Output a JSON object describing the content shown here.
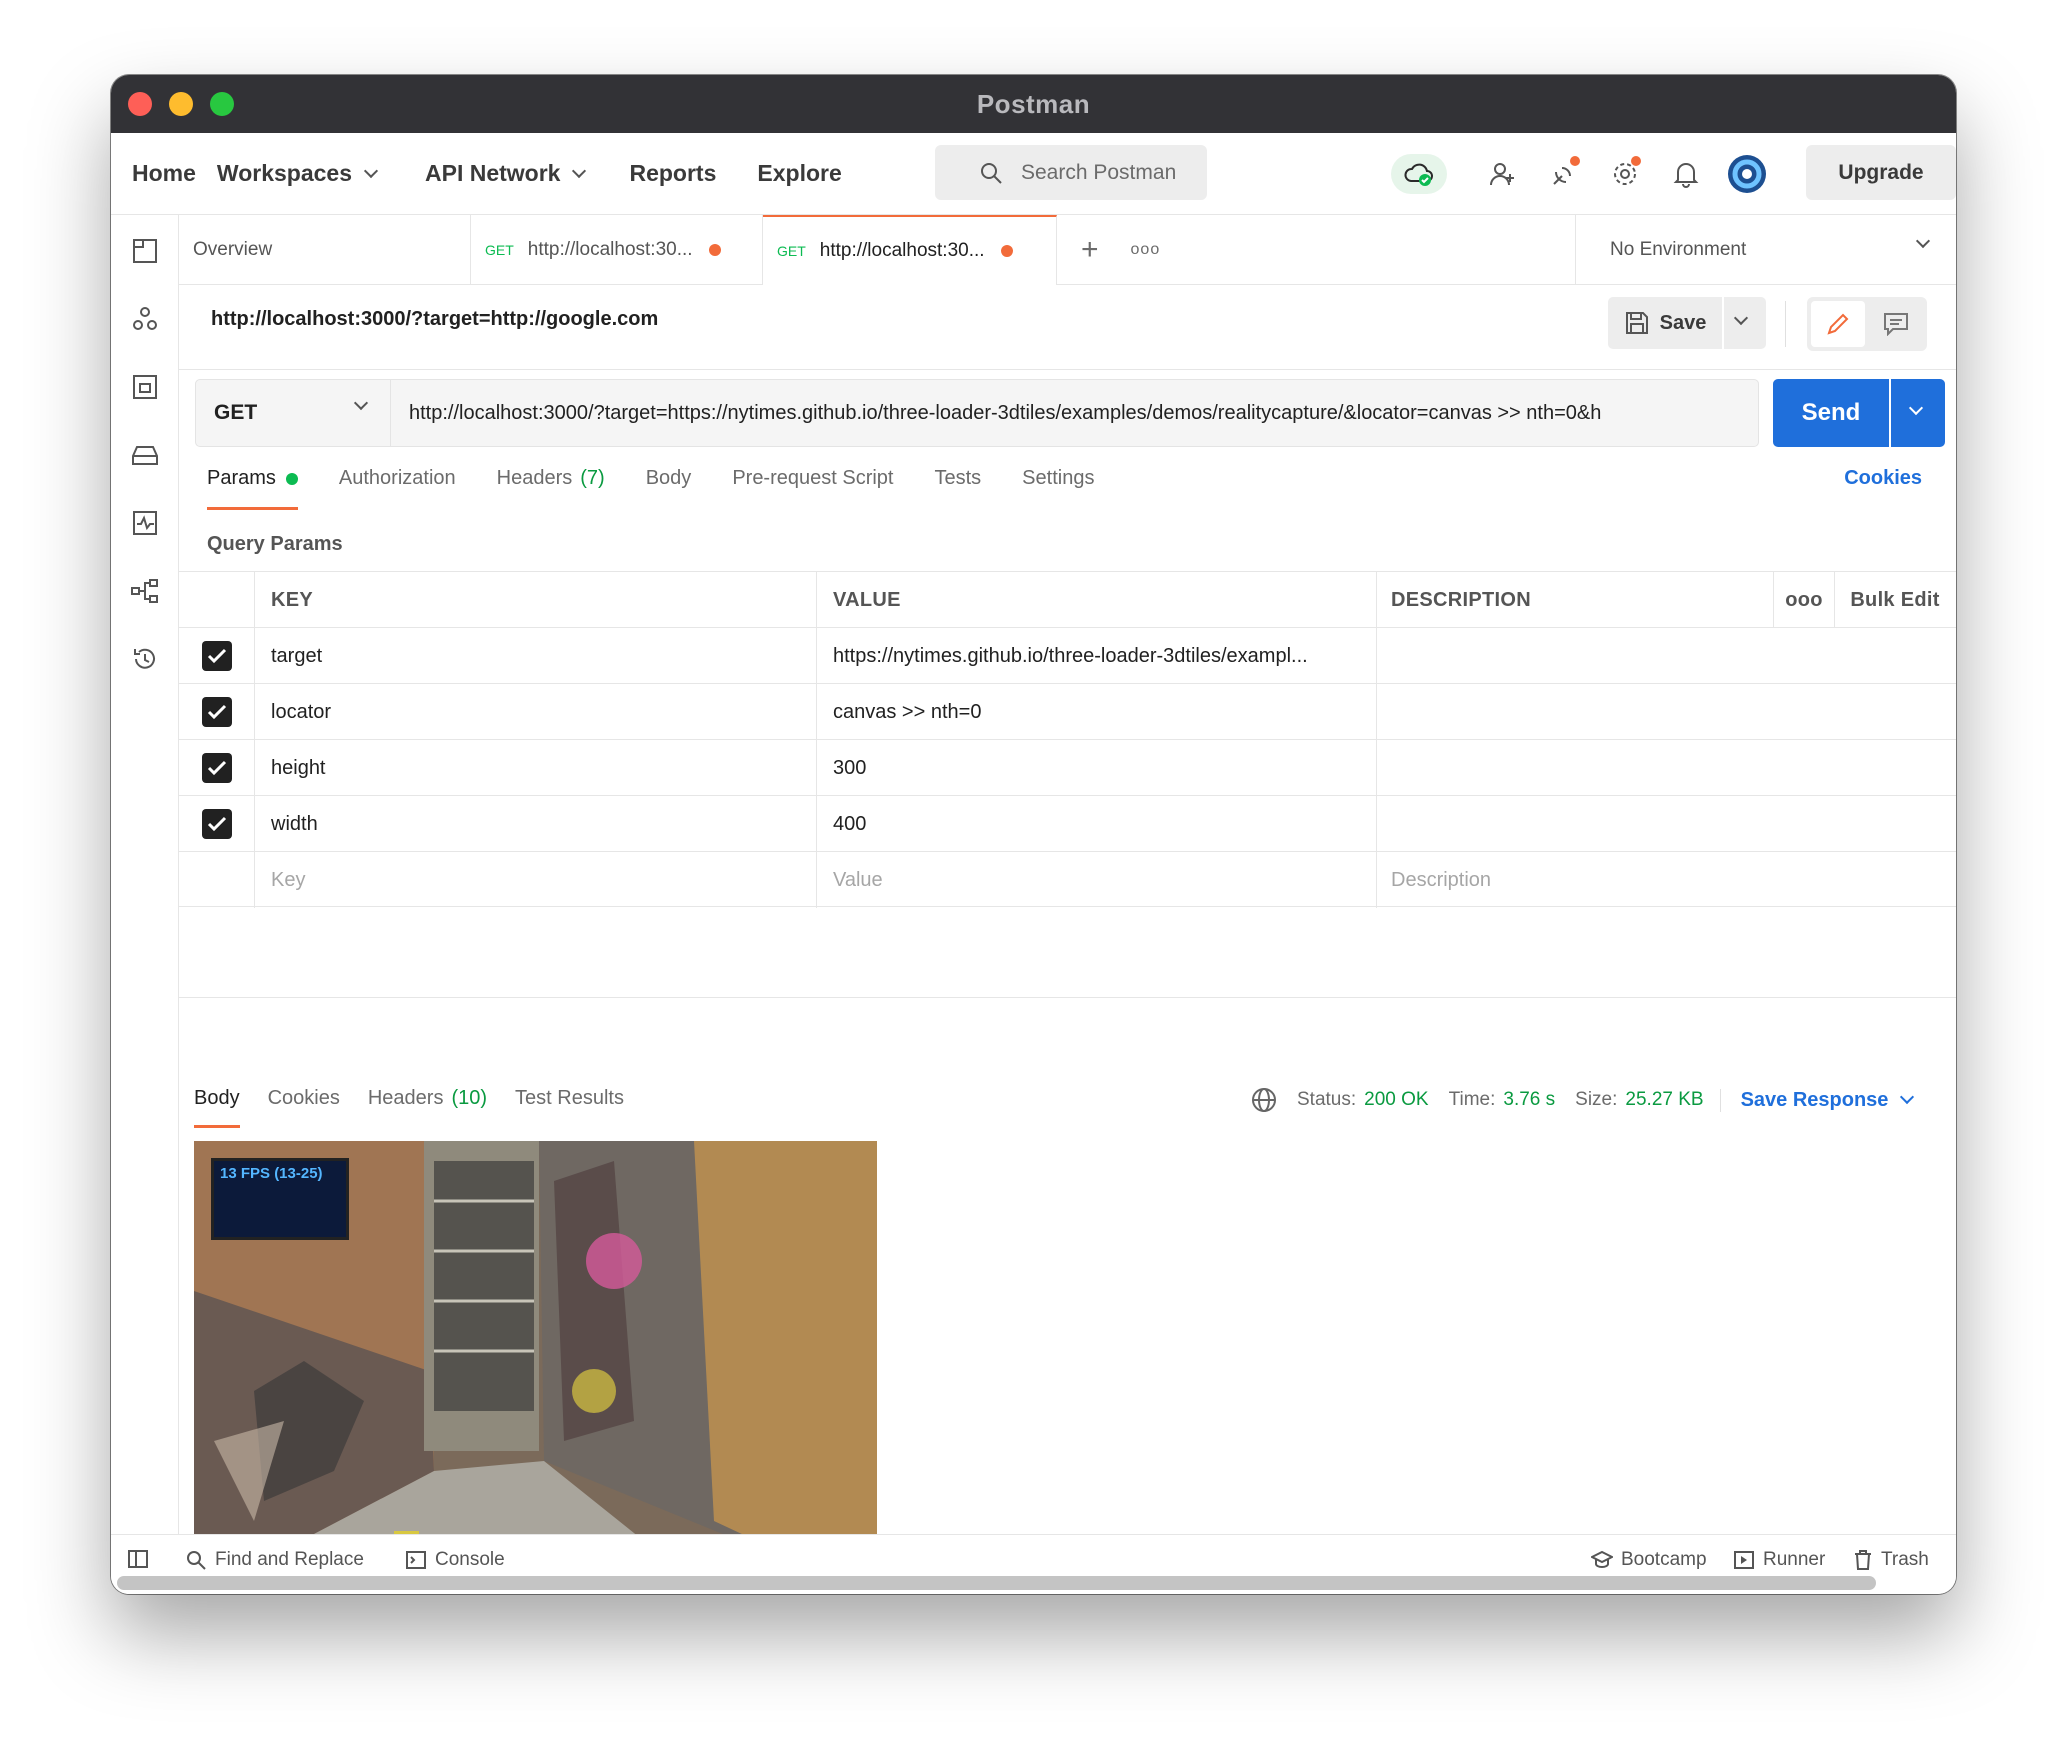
{
  "window": {
    "title": "Postman"
  },
  "nav": {
    "items": [
      "Home",
      "Workspaces",
      "API Network",
      "Reports",
      "Explore"
    ],
    "search_placeholder": "Search Postman",
    "upgrade_label": "Upgrade"
  },
  "tabs": {
    "overview": "Overview",
    "items": [
      {
        "method": "GET",
        "label": "http://localhost:30..."
      },
      {
        "method": "GET",
        "label": "http://localhost:30..."
      }
    ],
    "add": "+",
    "more": "ooo",
    "environment": "No Environment"
  },
  "request": {
    "name": "http://localhost:3000/?target=http://google.com",
    "save_label": "Save",
    "method": "GET",
    "url": "http://localhost:3000/?target=https://nytimes.github.io/three-loader-3dtiles/examples/demos/realitycapture/&locator=canvas >> nth=0&h",
    "send_label": "Send"
  },
  "request_tabs": {
    "params": "Params",
    "authorization": "Authorization",
    "headers": "Headers",
    "headers_count": "(7)",
    "body": "Body",
    "pre_request": "Pre-request Script",
    "tests": "Tests",
    "settings": "Settings",
    "cookies": "Cookies"
  },
  "query_params": {
    "title": "Query Params",
    "headers": {
      "key": "KEY",
      "value": "VALUE",
      "description": "DESCRIPTION",
      "more": "ooo",
      "bulk_edit": "Bulk Edit"
    },
    "rows": [
      {
        "key": "target",
        "value": "https://nytimes.github.io/three-loader-3dtiles/exampl..."
      },
      {
        "key": "locator",
        "value": "canvas >> nth=0"
      },
      {
        "key": "height",
        "value": "300"
      },
      {
        "key": "width",
        "value": "400"
      }
    ],
    "placeholders": {
      "key": "Key",
      "value": "Value",
      "description": "Description"
    }
  },
  "response": {
    "tabs": {
      "body": "Body",
      "cookies": "Cookies",
      "headers": "Headers",
      "headers_count": "(10)",
      "test_results": "Test Results"
    },
    "status_label": "Status:",
    "status_value": "200 OK",
    "time_label": "Time:",
    "time_value": "3.76 s",
    "size_label": "Size:",
    "size_value": "25.27 KB",
    "save_response": "Save Response",
    "preview_overlay": "13 FPS (13-25)",
    "code_toggle": "<>"
  },
  "footer": {
    "find_replace": "Find and Replace",
    "console": "Console",
    "bootcamp": "Bootcamp",
    "runner": "Runner",
    "trash": "Trash"
  },
  "colors": {
    "accent": "#f26b3a",
    "send": "#1f6fdb",
    "method_get": "#0cbb52",
    "status_ok": "#0a9a40"
  }
}
